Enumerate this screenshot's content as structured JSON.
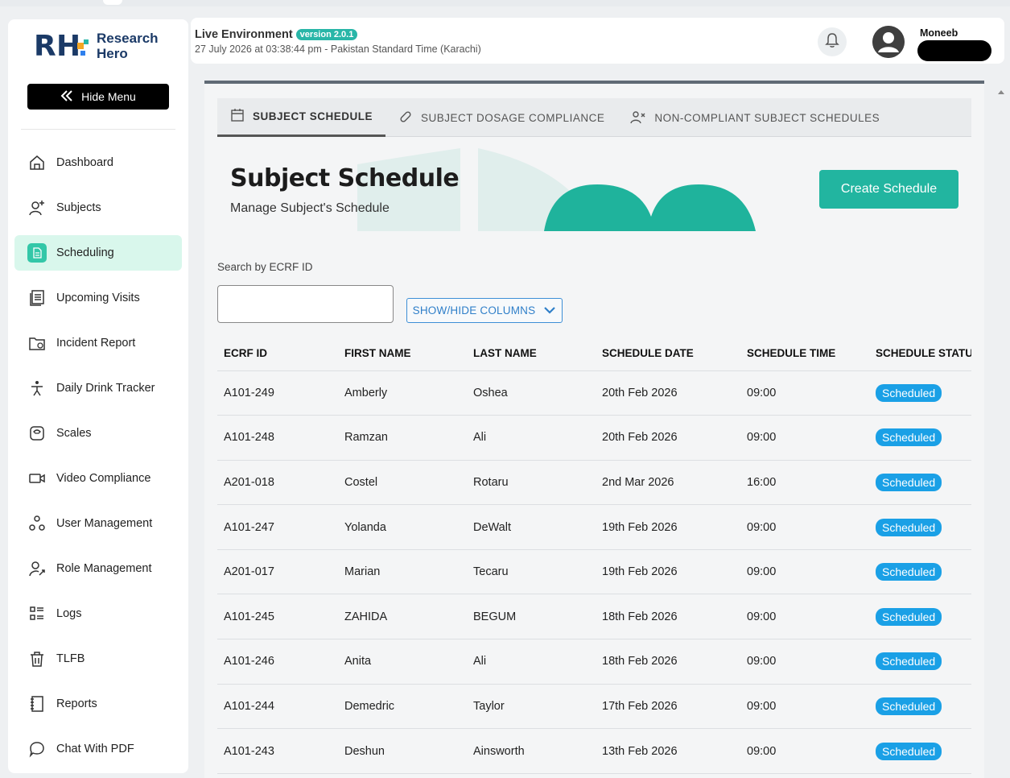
{
  "brand": {
    "line1": "Research",
    "line2": "Hero",
    "mark": "RH"
  },
  "sidebar": {
    "hide_menu_label": "Hide Menu",
    "items": [
      {
        "label": "Dashboard",
        "icon": "home-icon"
      },
      {
        "label": "Subjects",
        "icon": "user-add-icon"
      },
      {
        "label": "Scheduling",
        "icon": "document-icon",
        "active": true
      },
      {
        "label": "Upcoming Visits",
        "icon": "list-doc-icon"
      },
      {
        "label": "Incident Report",
        "icon": "folder-alert-icon"
      },
      {
        "label": "Daily Drink Tracker",
        "icon": "person-icon"
      },
      {
        "label": "Scales",
        "icon": "scale-icon"
      },
      {
        "label": "Video Compliance",
        "icon": "video-icon"
      },
      {
        "label": "User Management",
        "icon": "users-network-icon"
      },
      {
        "label": "Role Management",
        "icon": "user-role-icon"
      },
      {
        "label": "Logs",
        "icon": "logs-icon"
      },
      {
        "label": "TLFB",
        "icon": "trash-calendar-icon"
      },
      {
        "label": "Reports",
        "icon": "notebook-icon"
      },
      {
        "label": "Chat With PDF",
        "icon": "chat-icon"
      }
    ]
  },
  "header": {
    "env_title": "Live Environment",
    "version": "version 2.0.1",
    "datetime": "27 July 2026 at 03:38:44 pm - Pakistan Standard Time (Karachi)",
    "user_name": "Moneeb"
  },
  "tabs": [
    {
      "label": "SUBJECT SCHEDULE",
      "icon": "calendar-icon",
      "active": true
    },
    {
      "label": "SUBJECT DOSAGE COMPLIANCE",
      "icon": "pill-icon"
    },
    {
      "label": "NON-COMPLIANT SUBJECT SCHEDULES",
      "icon": "user-x-icon"
    }
  ],
  "page": {
    "title": "Subject Schedule",
    "subtitle": "Manage Subject's Schedule",
    "create_button": "Create Schedule",
    "search_label": "Search by ECRF ID",
    "search_value": "",
    "columns_button": "SHOW/HIDE COLUMNS"
  },
  "colors": {
    "accent": "#22b5a0",
    "status": "#1aa0e6",
    "active_nav": "#d9f7ec"
  },
  "table": {
    "headers": [
      "ECRF ID",
      "FIRST NAME",
      "LAST NAME",
      "SCHEDULE DATE",
      "SCHEDULE TIME",
      "SCHEDULE STATUS"
    ],
    "rows": [
      [
        "A101-249",
        "Amberly",
        "Oshea",
        "20th Feb 2026",
        "09:00",
        "Scheduled"
      ],
      [
        "A101-248",
        "Ramzan",
        "Ali",
        "20th Feb 2026",
        "09:00",
        "Scheduled"
      ],
      [
        "A201-018",
        "Costel",
        "Rotaru",
        "2nd Mar 2026",
        "16:00",
        "Scheduled"
      ],
      [
        "A101-247",
        "Yolanda",
        "DeWalt",
        "19th Feb 2026",
        "09:00",
        "Scheduled"
      ],
      [
        "A201-017",
        "Marian",
        "Tecaru",
        "19th Feb 2026",
        "09:00",
        "Scheduled"
      ],
      [
        "A101-245",
        "ZAHIDA",
        "BEGUM",
        "18th Feb 2026",
        "09:00",
        "Scheduled"
      ],
      [
        "A101-246",
        "Anita",
        "Ali",
        "18th Feb 2026",
        "09:00",
        "Scheduled"
      ],
      [
        "A101-244",
        "Demedric",
        "Taylor",
        "17th Feb 2026",
        "09:00",
        "Scheduled"
      ],
      [
        "A101-243",
        "Deshun",
        "Ainsworth",
        "13th Feb 2026",
        "09:00",
        "Scheduled"
      ]
    ]
  }
}
